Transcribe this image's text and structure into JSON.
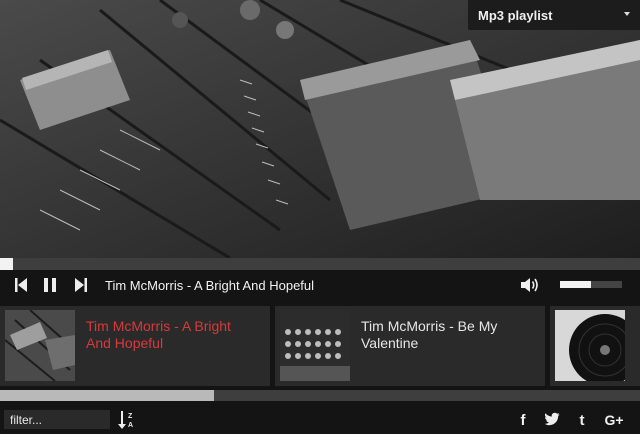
{
  "playlist_select": {
    "value": "Mp3 playlist"
  },
  "player": {
    "progress_fraction": 0.02,
    "now_playing": "Tim McMorris - A Bright And Hopeful",
    "volume_fraction": 0.5
  },
  "tracks": [
    {
      "title": "Tim McMorris - A Bright And Hopeful",
      "active": true
    },
    {
      "title": "Tim McMorris - Be My Valentine",
      "active": false
    },
    {
      "title": "",
      "active": false
    }
  ],
  "carousel_scroll_fraction": 0.33,
  "footer": {
    "filter_placeholder": "filter...",
    "sort_label": "Z A",
    "social": [
      "facebook-icon",
      "twitter-icon",
      "tumblr-icon",
      "google-plus-icon"
    ]
  },
  "colors": {
    "accent": "#d9393c",
    "bar": "#141414",
    "card": "#2a2a2a"
  }
}
